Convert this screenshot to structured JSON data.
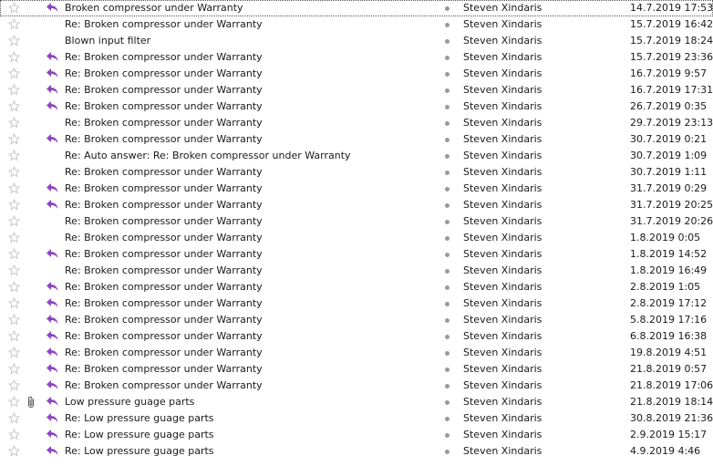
{
  "messages": [
    {
      "subject": "Broken compressor under Warranty",
      "sender": "Steven Xindaris",
      "date": "14.7.2019 17:53",
      "replied": true,
      "attachment": false,
      "selected": true
    },
    {
      "subject": "Re: Broken compressor under Warranty",
      "sender": "Steven Xindaris",
      "date": "15.7.2019 16:42",
      "replied": false,
      "attachment": false,
      "selected": false
    },
    {
      "subject": "Blown input filter",
      "sender": "Steven Xindaris",
      "date": "15.7.2019 18:24",
      "replied": false,
      "attachment": false,
      "selected": false
    },
    {
      "subject": "Re: Broken compressor under Warranty",
      "sender": "Steven Xindaris",
      "date": "15.7.2019 23:36",
      "replied": true,
      "attachment": false,
      "selected": false
    },
    {
      "subject": "Re: Broken compressor under Warranty",
      "sender": "Steven Xindaris",
      "date": "16.7.2019 9:57",
      "replied": true,
      "attachment": false,
      "selected": false
    },
    {
      "subject": "Re: Broken compressor under Warranty",
      "sender": "Steven Xindaris",
      "date": "16.7.2019 17:31",
      "replied": true,
      "attachment": false,
      "selected": false
    },
    {
      "subject": "Re: Broken compressor under Warranty",
      "sender": "Steven Xindaris",
      "date": "26.7.2019 0:35",
      "replied": true,
      "attachment": false,
      "selected": false
    },
    {
      "subject": "Re: Broken compressor under Warranty",
      "sender": "Steven Xindaris",
      "date": "29.7.2019 23:13",
      "replied": false,
      "attachment": false,
      "selected": false
    },
    {
      "subject": "Re: Broken compressor under Warranty",
      "sender": "Steven Xindaris",
      "date": "30.7.2019 0:21",
      "replied": true,
      "attachment": false,
      "selected": false
    },
    {
      "subject": "Re: Auto answer: Re: Broken compressor under Warranty",
      "sender": "Steven Xindaris",
      "date": "30.7.2019 1:09",
      "replied": false,
      "attachment": false,
      "selected": false
    },
    {
      "subject": "Re: Broken compressor under Warranty",
      "sender": "Steven Xindaris",
      "date": "30.7.2019 1:11",
      "replied": false,
      "attachment": false,
      "selected": false
    },
    {
      "subject": "Re: Broken compressor under Warranty",
      "sender": "Steven Xindaris",
      "date": "31.7.2019 0:29",
      "replied": true,
      "attachment": false,
      "selected": false
    },
    {
      "subject": "Re: Broken compressor under Warranty",
      "sender": "Steven Xindaris",
      "date": "31.7.2019 20:25",
      "replied": true,
      "attachment": false,
      "selected": false
    },
    {
      "subject": "Re: Broken compressor under Warranty",
      "sender": "Steven Xindaris",
      "date": "31.7.2019 20:26",
      "replied": false,
      "attachment": false,
      "selected": false
    },
    {
      "subject": "Re: Broken compressor under Warranty",
      "sender": "Steven Xindaris",
      "date": "1.8.2019 0:05",
      "replied": false,
      "attachment": false,
      "selected": false
    },
    {
      "subject": "Re: Broken compressor under Warranty",
      "sender": "Steven Xindaris",
      "date": "1.8.2019 14:52",
      "replied": true,
      "attachment": false,
      "selected": false
    },
    {
      "subject": "Re: Broken compressor under Warranty",
      "sender": "Steven Xindaris",
      "date": "1.8.2019 16:49",
      "replied": false,
      "attachment": false,
      "selected": false
    },
    {
      "subject": "Re: Broken compressor under Warranty",
      "sender": "Steven Xindaris",
      "date": "2.8.2019 1:05",
      "replied": true,
      "attachment": false,
      "selected": false
    },
    {
      "subject": "Re: Broken compressor under Warranty",
      "sender": "Steven Xindaris",
      "date": "2.8.2019 17:12",
      "replied": true,
      "attachment": false,
      "selected": false
    },
    {
      "subject": "Re: Broken compressor under Warranty",
      "sender": "Steven Xindaris",
      "date": "5.8.2019 17:16",
      "replied": true,
      "attachment": false,
      "selected": false
    },
    {
      "subject": "Re: Broken compressor under Warranty",
      "sender": "Steven Xindaris",
      "date": "6.8.2019 16:38",
      "replied": true,
      "attachment": false,
      "selected": false
    },
    {
      "subject": "Re: Broken compressor under Warranty",
      "sender": "Steven Xindaris",
      "date": "19.8.2019 4:51",
      "replied": true,
      "attachment": false,
      "selected": false
    },
    {
      "subject": "Re: Broken compressor under Warranty",
      "sender": "Steven Xindaris",
      "date": "21.8.2019 0:57",
      "replied": true,
      "attachment": false,
      "selected": false
    },
    {
      "subject": "Re: Broken compressor under Warranty",
      "sender": "Steven Xindaris",
      "date": "21.8.2019 17:06",
      "replied": true,
      "attachment": false,
      "selected": false
    },
    {
      "subject": "Low pressure guage parts",
      "sender": "Steven Xindaris",
      "date": "21.8.2019 18:14",
      "replied": true,
      "attachment": true,
      "selected": false
    },
    {
      "subject": "Re: Low pressure guage parts",
      "sender": "Steven Xindaris",
      "date": "30.8.2019 21:36",
      "replied": true,
      "attachment": false,
      "selected": false
    },
    {
      "subject": "Re: Low pressure guage parts",
      "sender": "Steven Xindaris",
      "date": "2.9.2019 15:17",
      "replied": true,
      "attachment": false,
      "selected": false
    },
    {
      "subject": "Re: Low pressure guage parts",
      "sender": "Steven Xindaris",
      "date": "4.9.2019 4:46",
      "replied": true,
      "attachment": false,
      "selected": false
    }
  ],
  "icons": {
    "star": "star-icon",
    "replied": "replied-icon",
    "attachment": "paperclip-icon",
    "read": "read-status-dot"
  },
  "colors": {
    "star_outline": "#c8c8c8",
    "replied_arrow": "#8e44c2",
    "read_dot": "#9a9a9a",
    "text": "#1a1a1a"
  }
}
